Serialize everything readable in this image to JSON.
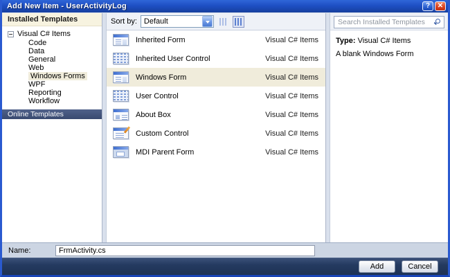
{
  "window": {
    "title": "Add New Item - UserActivityLog",
    "help_glyph": "?",
    "close_glyph": "✕"
  },
  "sidebar": {
    "installed_header": "Installed Templates",
    "online_header": "Online Templates",
    "tree": {
      "root": "Visual C# Items",
      "children": [
        "Code",
        "Data",
        "General",
        "Web",
        "Windows Forms",
        "WPF",
        "Reporting",
        "Workflow"
      ],
      "selected": "Windows Forms"
    }
  },
  "toolbar": {
    "sort_label": "Sort by:",
    "sort_value": "Default"
  },
  "list": {
    "items": [
      {
        "label": "Inherited Form",
        "category": "Visual C# Items",
        "icon": "inherited-form-icon"
      },
      {
        "label": "Inherited User Control",
        "category": "Visual C# Items",
        "icon": "inherited-user-control-icon"
      },
      {
        "label": "Windows Form",
        "category": "Visual C# Items",
        "icon": "windows-form-icon",
        "selected": true
      },
      {
        "label": "User Control",
        "category": "Visual C# Items",
        "icon": "user-control-icon"
      },
      {
        "label": "About Box",
        "category": "Visual C# Items",
        "icon": "about-box-icon"
      },
      {
        "label": "Custom Control",
        "category": "Visual C# Items",
        "icon": "custom-control-icon"
      },
      {
        "label": "MDI Parent Form",
        "category": "Visual C# Items",
        "icon": "mdi-parent-form-icon"
      }
    ]
  },
  "search": {
    "placeholder": "Search Installed Templates"
  },
  "details": {
    "type_label": "Type:",
    "type_value": "Visual C# Items",
    "description": "A blank Windows Form"
  },
  "name_row": {
    "label": "Name:",
    "value": "FrmActivity.cs"
  },
  "footer": {
    "add_label": "Add",
    "cancel_label": "Cancel"
  },
  "colors": {
    "titlebar_blue": "#1e4fc4",
    "window_border_blue": "#2a5ad0",
    "selection_cream": "#f0ecdb",
    "online_header_slate": "#40537a",
    "footer_navy": "#243a60"
  }
}
